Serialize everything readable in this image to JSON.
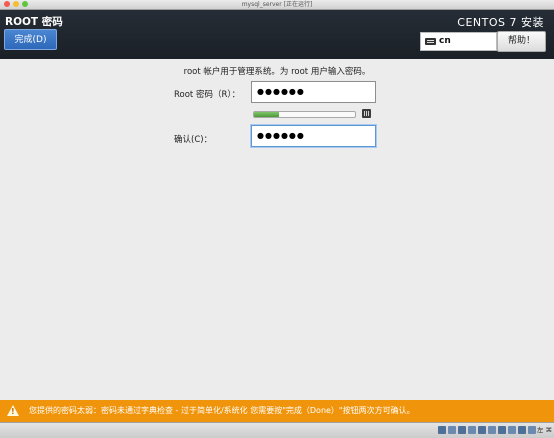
{
  "window": {
    "title": "mysql_server [正在运行]"
  },
  "header": {
    "page_title": "ROOT 密码",
    "done_label": "完成(D)",
    "product": "CENTOS 7 安装",
    "keyboard_layout": "cn",
    "help_label": "帮助！"
  },
  "form": {
    "intro": "root 帐户用于管理系统。为 root 用户输入密码。",
    "password_label": "Root 密码（R）：",
    "password_value": "●●●●●●",
    "strength_level": 0.25,
    "confirm_label": "确认(C)：",
    "confirm_value": "●●●●●●"
  },
  "warning": {
    "text": "您提供的密码太弱：密码未通过字典检查 - 过于简单化/系统化 您需要按\"完成（Done）\"按钮两次方可确认。"
  },
  "statusbar": {
    "host_key": "左 ⌘"
  },
  "colors": {
    "header_bg": "#1f242b",
    "done_button": "#3a78c8",
    "warning_bg": "#f0950b",
    "strength_fill": "#5aa849",
    "focus_border": "#5c97d6"
  }
}
